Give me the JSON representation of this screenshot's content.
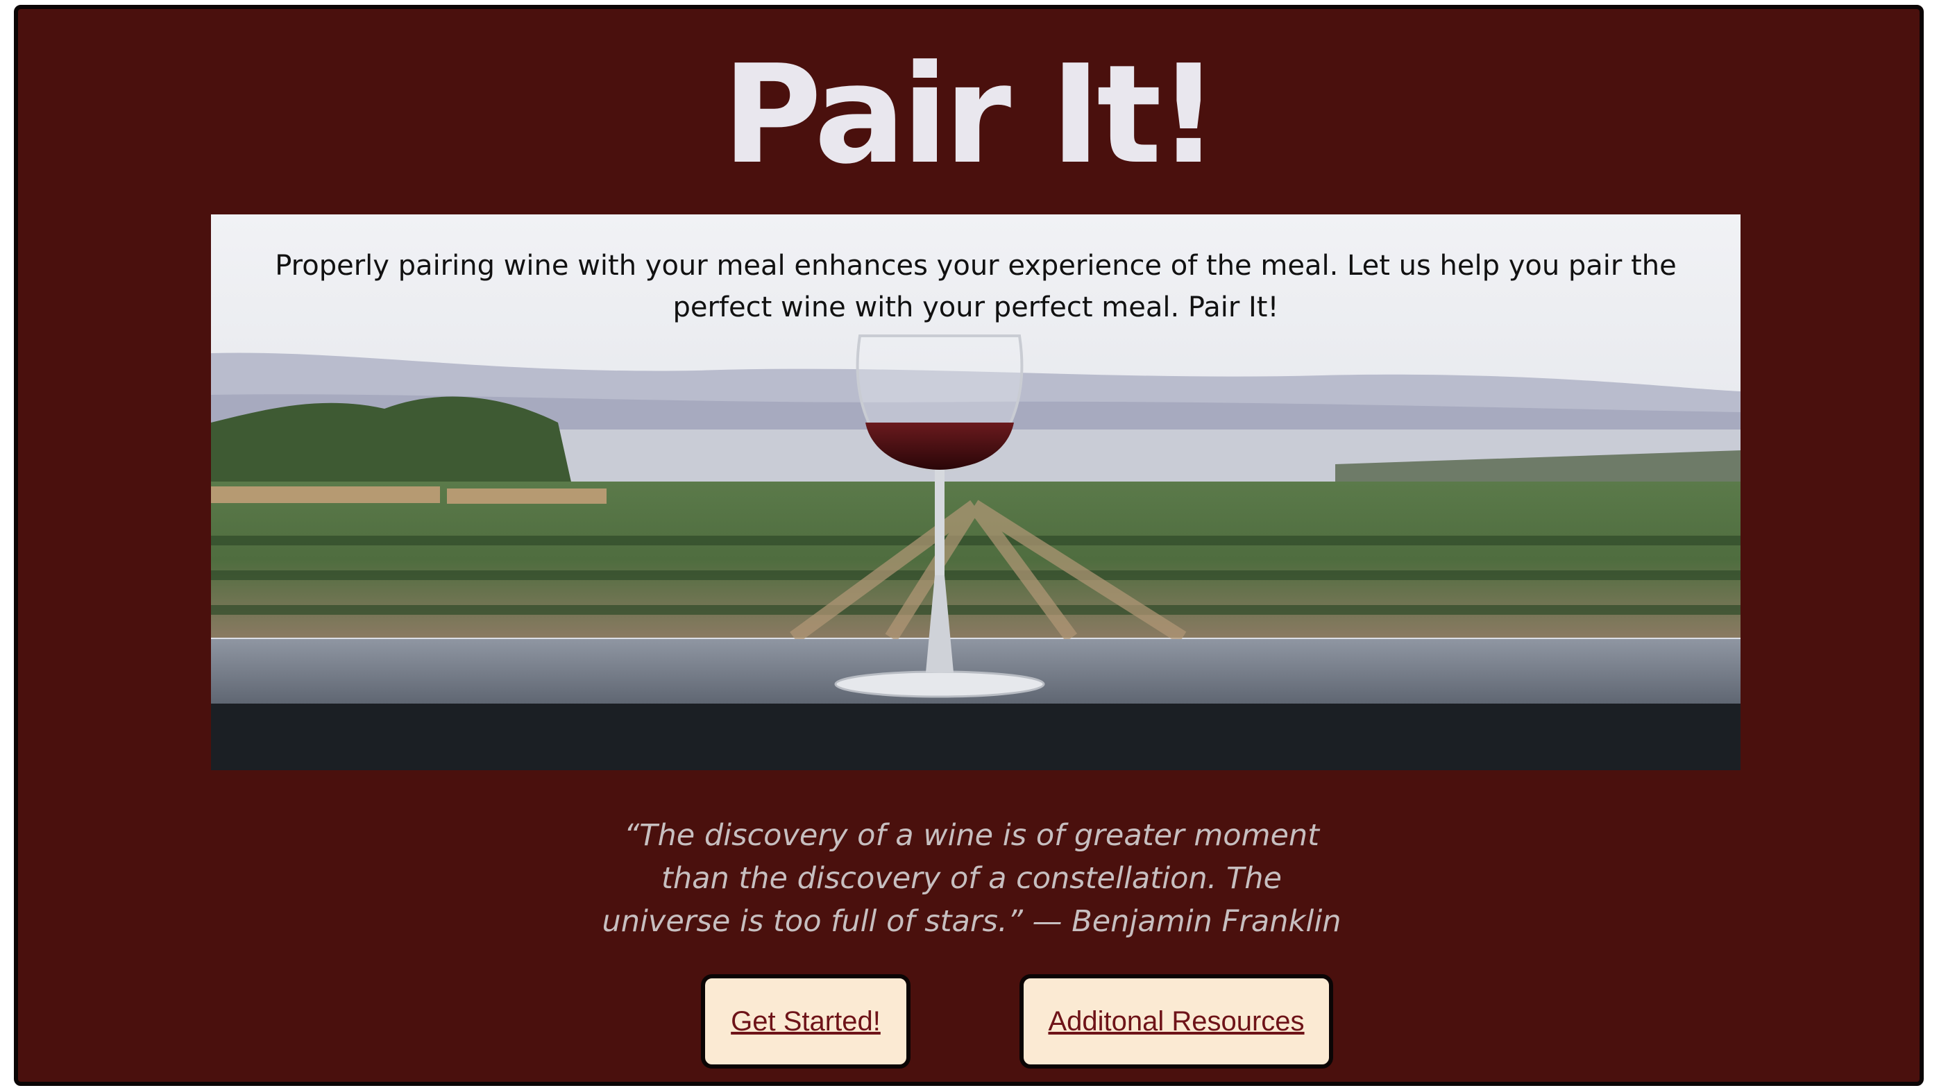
{
  "header": {
    "title": "Pair It!"
  },
  "hero": {
    "text": "Properly pairing wine with your meal enhances your experience of the meal. Let us help you pair the perfect wine with your perfect meal. Pair It!"
  },
  "quote": {
    "text": "“The discovery of a wine is of greater moment than the discovery of a constellation. The universe is too full of stars.” — Benjamin Franklin"
  },
  "buttons": {
    "get_started": "Get Started!",
    "resources": "Additonal Resources"
  },
  "colors": {
    "background": "#4a100d",
    "title_text": "#e9e7ee",
    "button_bg": "#fbead3",
    "button_text": "#6e1318",
    "quote_text": "#c7bfc0"
  }
}
